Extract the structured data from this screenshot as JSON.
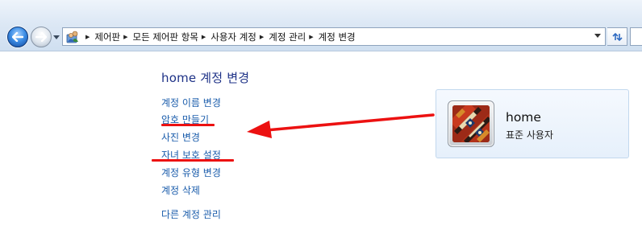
{
  "nav": {
    "back_icon": "back-arrow-icon",
    "forward_icon": "forward-arrow-icon",
    "breadcrumb": [
      "제어판",
      "모든 제어판 항목",
      "사용자 계정",
      "계정 관리",
      "계정 변경"
    ],
    "refresh_icon": "refresh-icon"
  },
  "main": {
    "title": "home 계정 변경",
    "links": [
      "계정 이름 변경",
      "암호 만들기",
      "사진 변경",
      "자녀 보호 설정",
      "계정 유형 변경",
      "계정 삭제"
    ],
    "other_link": "다른 계정 관리"
  },
  "account": {
    "name": "home",
    "type": "표준 사용자"
  },
  "annotation_color": "#ec1111",
  "link_color": "#1a5cab",
  "title_color": "#1e3287"
}
